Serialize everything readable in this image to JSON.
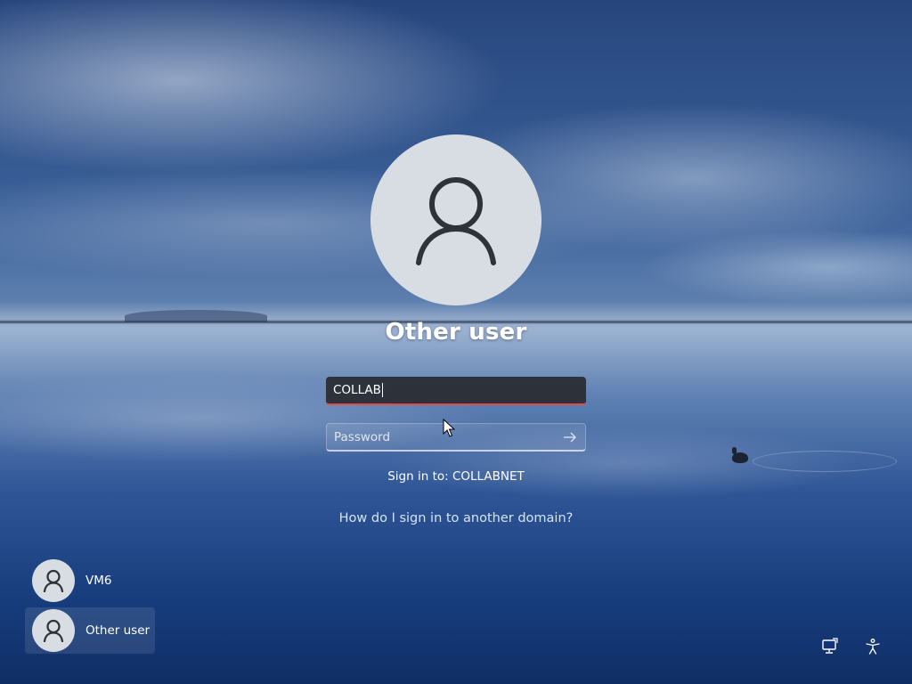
{
  "login": {
    "title": "Other user",
    "username_value": "COLLAB",
    "password_placeholder": "Password",
    "signin_to": "Sign in to: COLLABNET",
    "domain_help_link": "How do I sign in to another domain?"
  },
  "users": [
    {
      "name": "VM6",
      "selected": false
    },
    {
      "name": "Other user",
      "selected": true
    }
  ],
  "corner_icons": [
    "network-icon",
    "accessibility-icon"
  ],
  "colors": {
    "input_focus_underline": "#e04a4a",
    "avatar_bg": "#d8dde3",
    "link": "#d6e4f7"
  }
}
